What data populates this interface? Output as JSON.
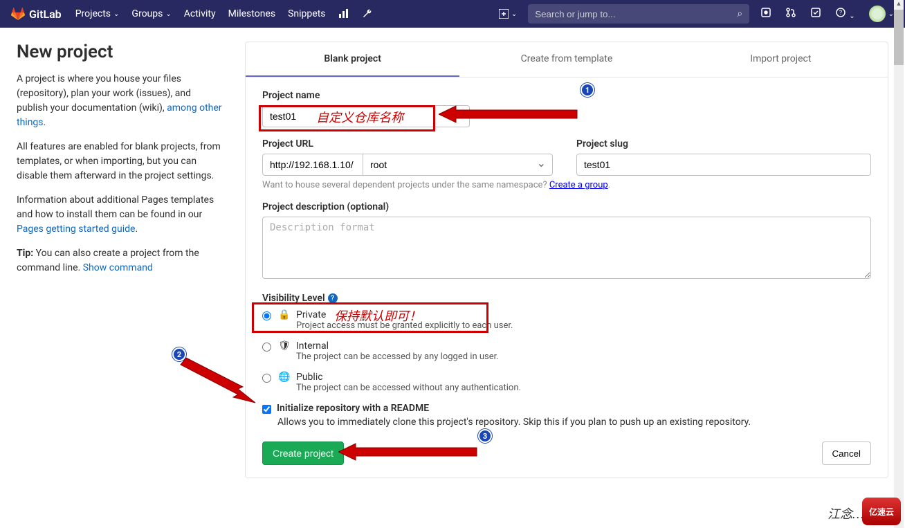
{
  "topbar": {
    "brand": "GitLab",
    "nav": {
      "projects": "Projects",
      "groups": "Groups",
      "activity": "Activity",
      "milestones": "Milestones",
      "snippets": "Snippets"
    },
    "search_placeholder": "Search or jump to..."
  },
  "side": {
    "title": "New project",
    "p1a": "A project is where you house your files (repository), plan your work (issues), and publish your documentation (wiki), ",
    "p1link": "among other things",
    "p1b": ".",
    "p2": "All features are enabled for blank projects, from templates, or when importing, but you can disable them afterward in the project settings.",
    "p3a": "Information about additional Pages templates and how to install them can be found in our ",
    "p3link": "Pages getting started guide",
    "p3b": ".",
    "p4a": "Tip:",
    "p4b": " You can also create a project from the command line. ",
    "p4link": "Show command"
  },
  "tabs": {
    "blank": "Blank project",
    "template": "Create from template",
    "import": "Import project"
  },
  "form": {
    "name_label": "Project name",
    "name_value": "test01",
    "url_label": "Project URL",
    "url_base": "http://192.168.1.10/",
    "url_ns": "root",
    "slug_label": "Project slug",
    "slug_value": "test01",
    "ns_hint_a": "Want to house several dependent projects under the same namespace? ",
    "ns_hint_link": "Create a group",
    "ns_hint_b": ".",
    "desc_label": "Project description (optional)",
    "desc_placeholder": "Description format",
    "vis_label": "Visibility Level",
    "vis": {
      "private": {
        "label": "Private",
        "desc": "Project access must be granted explicitly to each user."
      },
      "internal": {
        "label": "Internal",
        "desc": "The project can be accessed by any logged in user."
      },
      "public": {
        "label": "Public",
        "desc": "The project can be accessed without any authentication."
      }
    },
    "readme_label": "Initialize repository with a README",
    "readme_desc": "Allows you to immediately clone this project's repository. Skip this if you plan to push up an existing repository.",
    "create": "Create project",
    "cancel": "Cancel"
  },
  "annot": {
    "a1": "自定义仓库名称",
    "a2": "保持默认即可！",
    "b1": "1",
    "b2": "2",
    "b3": "3"
  },
  "watermark": {
    "text": "江念…",
    "logo": "亿速云"
  }
}
